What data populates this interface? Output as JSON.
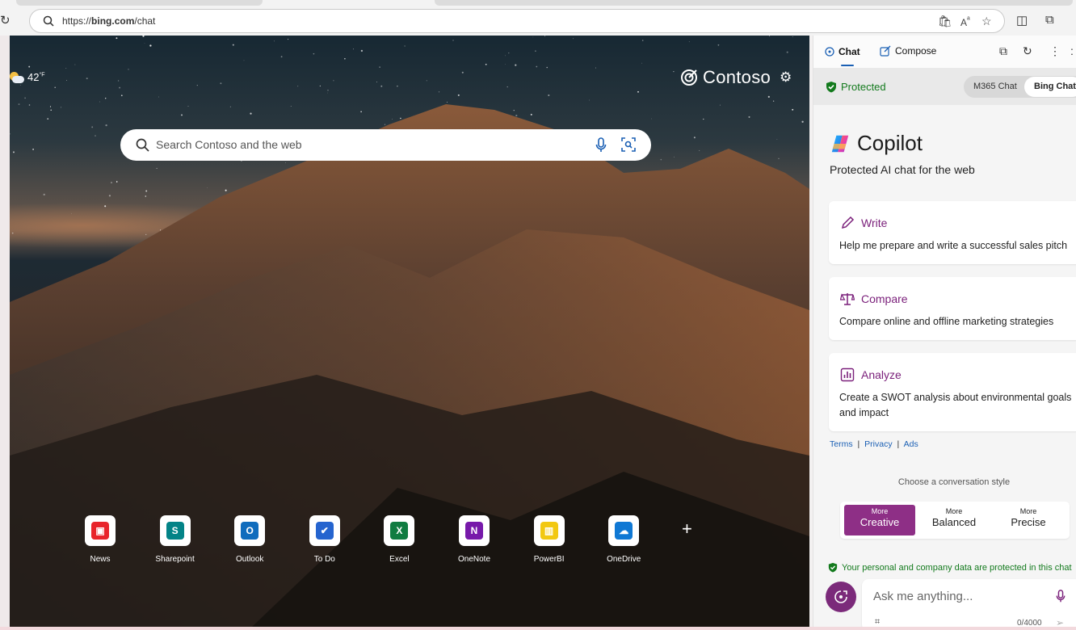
{
  "browser": {
    "url_prefix": "https://",
    "url_domain": "bing.com",
    "url_path": "/chat"
  },
  "ntp": {
    "weather_temp": "42",
    "weather_unit": "°F",
    "brand_name": "Contoso",
    "search_placeholder": "Search Contoso and the web",
    "quick_links": [
      {
        "label": "News",
        "icon": "news-icon",
        "color": "#e8242b",
        "glyph": "▣"
      },
      {
        "label": "Sharepoint",
        "icon": "sharepoint-icon",
        "color": "#038387",
        "glyph": "S"
      },
      {
        "label": "Outlook",
        "icon": "outlook-icon",
        "color": "#0f6cbd",
        "glyph": "O"
      },
      {
        "label": "To Do",
        "icon": "todo-icon",
        "color": "#2564cf",
        "glyph": "✔"
      },
      {
        "label": "Excel",
        "icon": "excel-icon",
        "color": "#107c41",
        "glyph": "X"
      },
      {
        "label": "OneNote",
        "icon": "onenote-icon",
        "color": "#7719aa",
        "glyph": "N"
      },
      {
        "label": "PowerBI",
        "icon": "powerbi-icon",
        "color": "#f2c811",
        "glyph": "▥"
      },
      {
        "label": "OneDrive",
        "icon": "onedrive-icon",
        "color": "#0f78d4",
        "glyph": "☁"
      }
    ]
  },
  "panel": {
    "tabs": {
      "chat": "Chat",
      "compose": "Compose"
    },
    "protected_label": "Protected",
    "mode_options": {
      "m365": "M365 Chat",
      "bing": "Bing Chat"
    },
    "title": "Copilot",
    "subtitle": "Protected AI chat for the web",
    "cards": [
      {
        "title": "Write",
        "icon": "pencil-icon",
        "body": "Help me prepare and write a successful sales pitch"
      },
      {
        "title": "Compare",
        "icon": "scales-icon",
        "body": "Compare online and offline marketing strategies"
      },
      {
        "title": "Analyze",
        "icon": "chart-icon",
        "body": "Create a SWOT analysis about environmental goals and impact"
      }
    ],
    "footer_links": {
      "terms": "Terms",
      "privacy": "Privacy",
      "ads": "Ads",
      "separator": "|"
    },
    "style_heading": "Choose a conversation style",
    "styles": [
      {
        "more": "More",
        "name": "Creative",
        "selected": true
      },
      {
        "more": "More",
        "name": "Balanced",
        "selected": false
      },
      {
        "more": "More",
        "name": "Precise",
        "selected": false
      }
    ],
    "privacy_note": "Your personal and company data are protected in this chat",
    "ask_placeholder": "Ask me anything...",
    "char_count": "0/4000"
  },
  "colors": {
    "accent_purple": "#8e2f86",
    "protected_green": "#137a1d",
    "link_blue": "#1a5fb4"
  }
}
